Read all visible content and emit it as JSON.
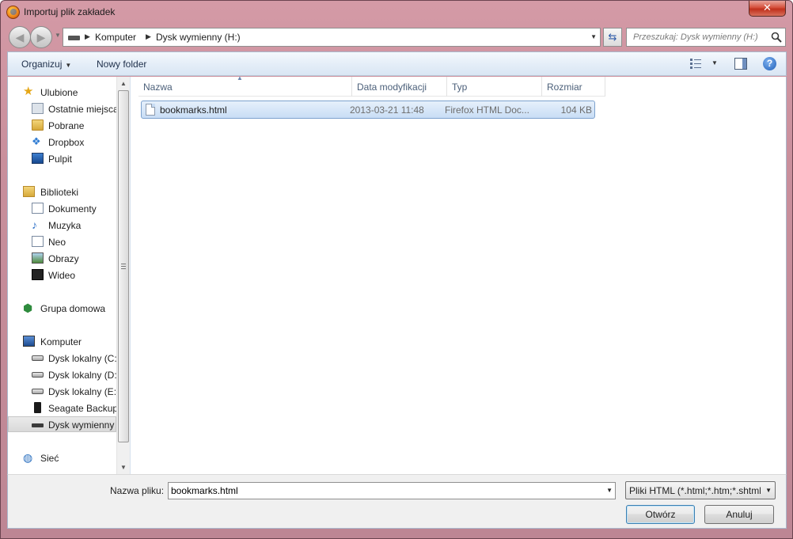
{
  "window": {
    "title": "Importuj plik zakładek"
  },
  "address": {
    "crumbs": [
      "Komputer",
      "Dysk wymienny (H:)"
    ]
  },
  "search": {
    "placeholder": "Przeszukaj: Dysk wymienny (H:)"
  },
  "toolbar": {
    "organize": "Organizuj",
    "new_folder": "Nowy folder"
  },
  "nav": {
    "favorites": "Ulubione",
    "recent": "Ostatnie miejsca",
    "downloads": "Pobrane",
    "dropbox": "Dropbox",
    "desktop": "Pulpit",
    "libraries": "Biblioteki",
    "documents": "Dokumenty",
    "music": "Muzyka",
    "neo": "Neo",
    "pictures": "Obrazy",
    "videos": "Wideo",
    "homegroup": "Grupa domowa",
    "computer": "Komputer",
    "drive_c": "Dysk lokalny (C:)",
    "drive_d": "Dysk lokalny (D:)",
    "drive_e": "Dysk lokalny (E:)",
    "seagate": "Seagate Backup",
    "removable": "Dysk wymienny",
    "network": "Sieć"
  },
  "columns": {
    "name": "Nazwa",
    "date": "Data modyfikacji",
    "type": "Typ",
    "size": "Rozmiar"
  },
  "files": [
    {
      "name": "bookmarks.html",
      "date": "2013-03-21 11:48",
      "type": "Firefox HTML Doc...",
      "size": "104 KB"
    }
  ],
  "bottom": {
    "filename_label": "Nazwa pliku:",
    "filename_value": "bookmarks.html",
    "filter": "Pliki HTML (*.html;*.htm;*.shtml",
    "open": "Otwórz",
    "cancel": "Anuluj"
  }
}
